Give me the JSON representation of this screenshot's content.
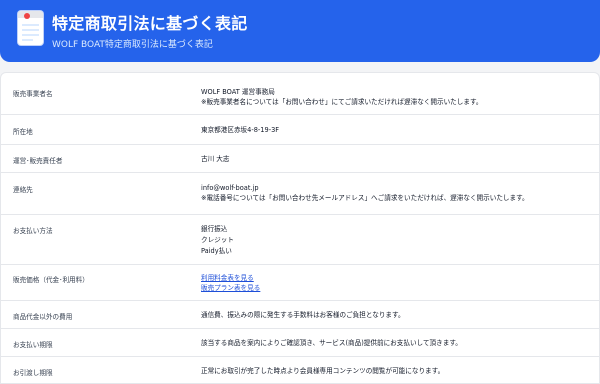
{
  "header": {
    "title": "特定商取引法に基づく表記",
    "subtitle": "WOLF BOAT特定商取引法に基づく表記",
    "icon": "document-icon",
    "accent_color": "#2563eb"
  },
  "rows": [
    {
      "label": "販売事業者名",
      "lines": [
        "WOLF BOAT 運営事務局",
        "※販売事業者名については「お問い合わせ」にてご請求いただければ遅滞なく開示いたします。"
      ]
    },
    {
      "label": "所在地",
      "lines": [
        "東京都港区赤坂4-8-19-3F"
      ]
    },
    {
      "label": "運営･販売責任者",
      "lines": [
        "古川 大志"
      ]
    },
    {
      "label": "連絡先",
      "lines": [
        "info@wolf-boat.jp",
        "※電話番号については「お問い合わせ先メールアドレス」へご請求をいただければ、遅滞なく開示いたします。"
      ]
    },
    {
      "label": "お支払い方法",
      "lines": [
        "銀行振込",
        "クレジット",
        "Paidy払い"
      ]
    },
    {
      "label": "販売価格（代金･利用料）",
      "links": [
        "利用料金表を見る",
        "販売プラン表を見る"
      ]
    },
    {
      "label": "商品代金以外の費用",
      "lines": [
        "通信費、振込みの際に発生する手数料はお客様のご負担となります。"
      ]
    },
    {
      "label": "お支払い期限",
      "lines": [
        "該当する商品を案内によりご確認頂き、サービス(商品)提供前にお支払いして頂きます。"
      ]
    },
    {
      "label": "お引渡し期限",
      "lines": [
        "正常にお取引が完了した時点より会員様専用コンテンツの閲覧が可能になります。"
      ]
    }
  ]
}
